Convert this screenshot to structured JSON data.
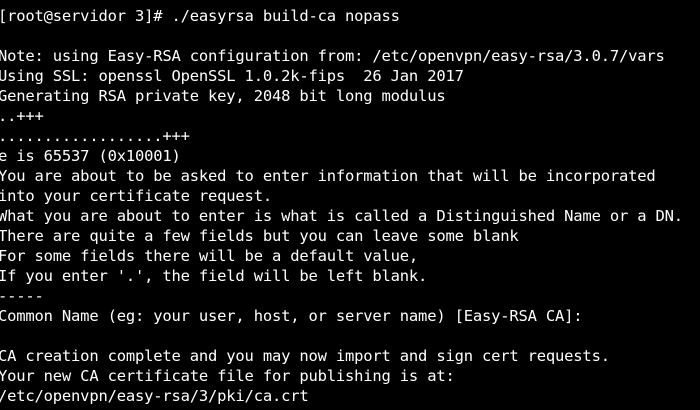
{
  "terminal": {
    "colors": {
      "background": "#000000",
      "foreground": "#ffffff"
    },
    "lines": [
      "[root@servidor 3]# ./easyrsa build-ca nopass",
      "",
      "Note: using Easy-RSA configuration from: /etc/openvpn/easy-rsa/3.0.7/vars",
      "Using SSL: openssl OpenSSL 1.0.2k-fips  26 Jan 2017",
      "Generating RSA private key, 2048 bit long modulus",
      "..+++",
      "..................+++",
      "e is 65537 (0x10001)",
      "You are about to be asked to enter information that will be incorporated",
      "into your certificate request.",
      "What you are about to enter is what is called a Distinguished Name or a DN.",
      "There are quite a few fields but you can leave some blank",
      "For some fields there will be a default value,",
      "If you enter '.', the field will be left blank.",
      "-----",
      "Common Name (eg: your user, host, or server name) [Easy-RSA CA]:",
      "",
      "CA creation complete and you may now import and sign cert requests.",
      "Your new CA certificate file for publishing is at:",
      "/etc/openvpn/easy-rsa/3/pki/ca.crt"
    ]
  }
}
